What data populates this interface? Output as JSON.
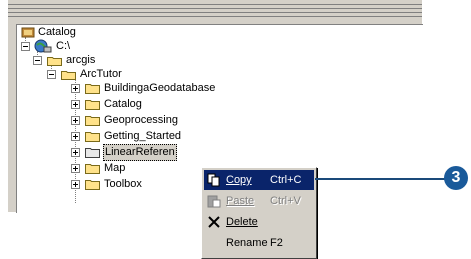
{
  "tree": {
    "root": {
      "label": "Catalog",
      "icon": "catalog-icon"
    },
    "drive": {
      "label": "C:\\",
      "icon": "drive-icon"
    },
    "arcgis": {
      "label": "arcgis"
    },
    "arctutor": {
      "label": "ArcTutor"
    },
    "children": [
      {
        "label": "BuildingaGeodatabase"
      },
      {
        "label": "Catalog"
      },
      {
        "label": "Geoprocessing"
      },
      {
        "label": "Getting_Started"
      },
      {
        "label": "LinearReferen"
      },
      {
        "label": "Map"
      },
      {
        "label": "Toolbox"
      }
    ]
  },
  "context_menu": {
    "items": [
      {
        "label": "Copy",
        "shortcut": "Ctrl+C",
        "icon": "copy-icon"
      },
      {
        "label": "Paste",
        "shortcut": "Ctrl+V",
        "icon": "paste-icon"
      },
      {
        "label": "Delete",
        "shortcut": "",
        "icon": "delete-icon"
      },
      {
        "label": "Rename",
        "shortcut": "F2",
        "icon": ""
      }
    ]
  },
  "callout": {
    "number": "3"
  },
  "colors": {
    "highlight": "#0a246a",
    "callout": "#1a5a9a",
    "folder": "#ffe28a"
  }
}
